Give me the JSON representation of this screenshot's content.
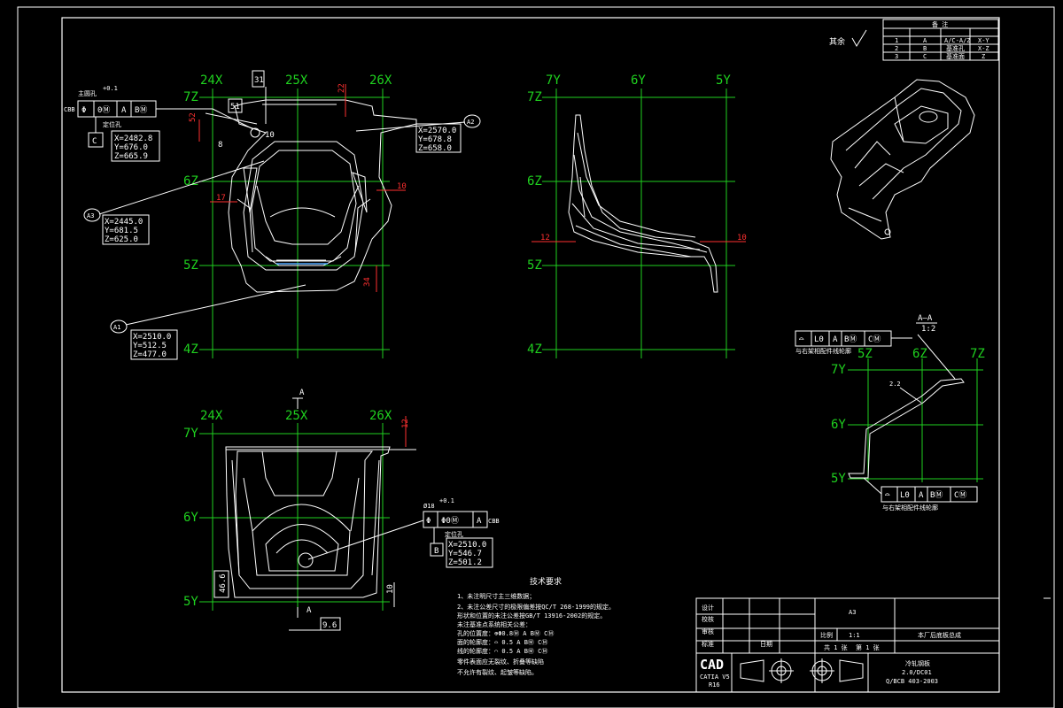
{
  "views": {
    "front": {
      "x_labels": [
        "24X",
        "25X",
        "26X"
      ],
      "z_labels": [
        "7Z",
        "6Z",
        "5Z",
        "4Z"
      ],
      "points": [
        {
          "id": "A2",
          "lines": [
            "X=2570.0",
            "Y=678.8",
            "Z=658.0"
          ]
        },
        {
          "id": "A3",
          "lines": [
            "X=2445.0",
            "Y=681.5",
            "Z=625.0"
          ]
        },
        {
          "id": "A1",
          "lines": [
            "X=2510.0",
            "Y=512.5",
            "Z=477.0"
          ]
        }
      ],
      "pin": {
        "title": "主圆孔",
        "tol": "+0.1",
        "frame": [
          "Φ",
          "0Ⓜ",
          "A",
          "BⓂ"
        ],
        "cbb": "CBB",
        "label": "定位孔",
        "datum": "C",
        "coords": [
          "X=2482.8",
          "Y=676.0",
          "Z=665.9"
        ]
      },
      "dims": {
        "d31": "31",
        "d22": "22",
        "d51": "51",
        "d52": "52",
        "d10a": "10",
        "d10b": "10",
        "d17": "17",
        "d34": "34",
        "d8": "8"
      }
    },
    "side": {
      "y_labels": [
        "7Y",
        "6Y",
        "5Y"
      ],
      "z_labels": [
        "7Z",
        "6Z",
        "5Z",
        "4Z"
      ],
      "dims": {
        "d12": "12",
        "d10": "10"
      }
    },
    "top": {
      "x_labels": [
        "24X",
        "25X",
        "26X"
      ],
      "y_labels": [
        "7Y",
        "6Y",
        "5Y"
      ],
      "section": "A",
      "dims": {
        "d12": "12",
        "d46": "46.6",
        "d10": "10",
        "d96": "9.6"
      },
      "hole": {
        "title": "Ø18",
        "tol": "+0.1",
        "frame": [
          "Φ",
          "Φ0Ⓜ",
          "A"
        ],
        "cbb": "CBB",
        "label": "定位孔",
        "datum": "B",
        "coords": [
          "X=2510.0",
          "Y=546.7",
          "Z=501.2"
        ]
      }
    },
    "section": {
      "title": "A–A",
      "scale": "1:2",
      "z_labels": [
        "5Z",
        "6Z",
        "7Z"
      ],
      "y_labels": [
        "7Y",
        "6Y",
        "5Y"
      ],
      "frame": [
        "⌓",
        "L0",
        "A",
        "BⓂ",
        "CⓂ"
      ],
      "note": "与右架相配件线轮廓",
      "dim": "2.2"
    }
  },
  "roughness": {
    "label": "其余"
  },
  "revision_table": {
    "title": "备 注",
    "headers": [
      "",
      "",
      "",
      ""
    ],
    "rows": [
      [
        "1",
        "A",
        "A/C-A/Z",
        "X-Y"
      ],
      [
        "2",
        "B",
        "基准孔",
        "X-Z"
      ],
      [
        "3",
        "C",
        "基准面",
        "Z"
      ]
    ]
  },
  "notes": {
    "title": "技术要求",
    "lines": [
      "1、未注明尺寸主三维数据；",
      "2、未注公差尺寸的极限偏差按QC/T 268-1999的规定。",
      "    形状和位置的未注公差按GB/T 13916-2002的规定。",
      "    未注基准点系统相关公差：",
      "    孔的位置度：⊕Φ0.8Ⓜ A BⓂ CⓂ",
      "    面的轮廓度：⌓ 0.5 A BⓂ CⓂ",
      "    线的轮廓度：⌒ 0.5 A BⓂ CⓂ",
      "    零件表面应无裂纹、折叠等缺陷",
      "    不允许有裂纹、起皱等缺陷。"
    ]
  },
  "title_block": {
    "rows": [
      "设计",
      "校核",
      "审核",
      "标准",
      "批准"
    ],
    "sign": "日期",
    "material": "A3",
    "scale_label": "比例",
    "scale": "1:1",
    "part_name": "本厂后底板总成",
    "sheets": "共 1 张",
    "sheet_no": "第 1 张",
    "logo": "CAD",
    "software": "CATIA V5",
    "release": "R16",
    "spec1": "冷轧钢板",
    "spec2": "2.0/DC01",
    "spec3": "Q/BCB 403-2003"
  }
}
